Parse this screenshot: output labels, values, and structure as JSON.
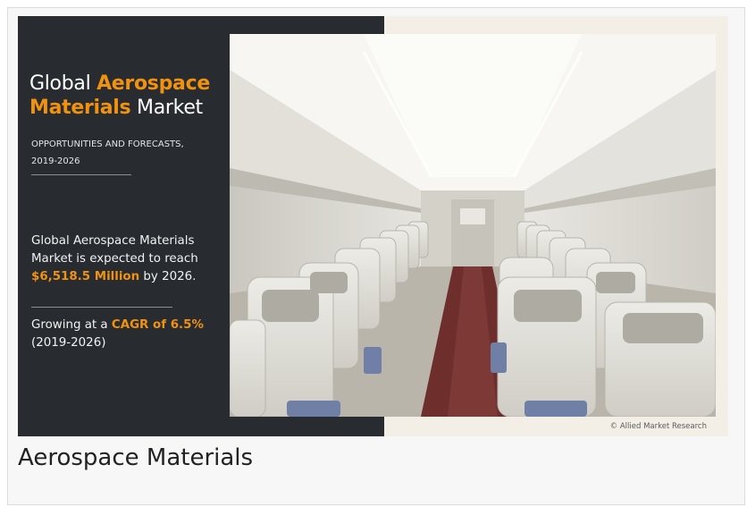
{
  "figure": {
    "headline": {
      "line1_plain": "Global ",
      "line1_accent": "Aerospace",
      "line2_accent": "Materials",
      "line2_plain": " Market"
    },
    "subtitle_line1": "OPPORTUNITIES AND FORECASTS,",
    "subtitle_line2": "2019-2026",
    "forecast": {
      "line1": "Global Aerospace Materials",
      "line2": "Market is expected to reach",
      "value": "$6,518.5 Million",
      "suffix": " by 2026."
    },
    "growth": {
      "prefix": "Growing at a ",
      "cagr": "CAGR of 6.5%",
      "period": "(2019-2026)"
    },
    "credit": "© Allied Market Research",
    "colors": {
      "accent": "#f0920f",
      "panel": "#282c31"
    }
  },
  "caption": "Aerospace Materials"
}
